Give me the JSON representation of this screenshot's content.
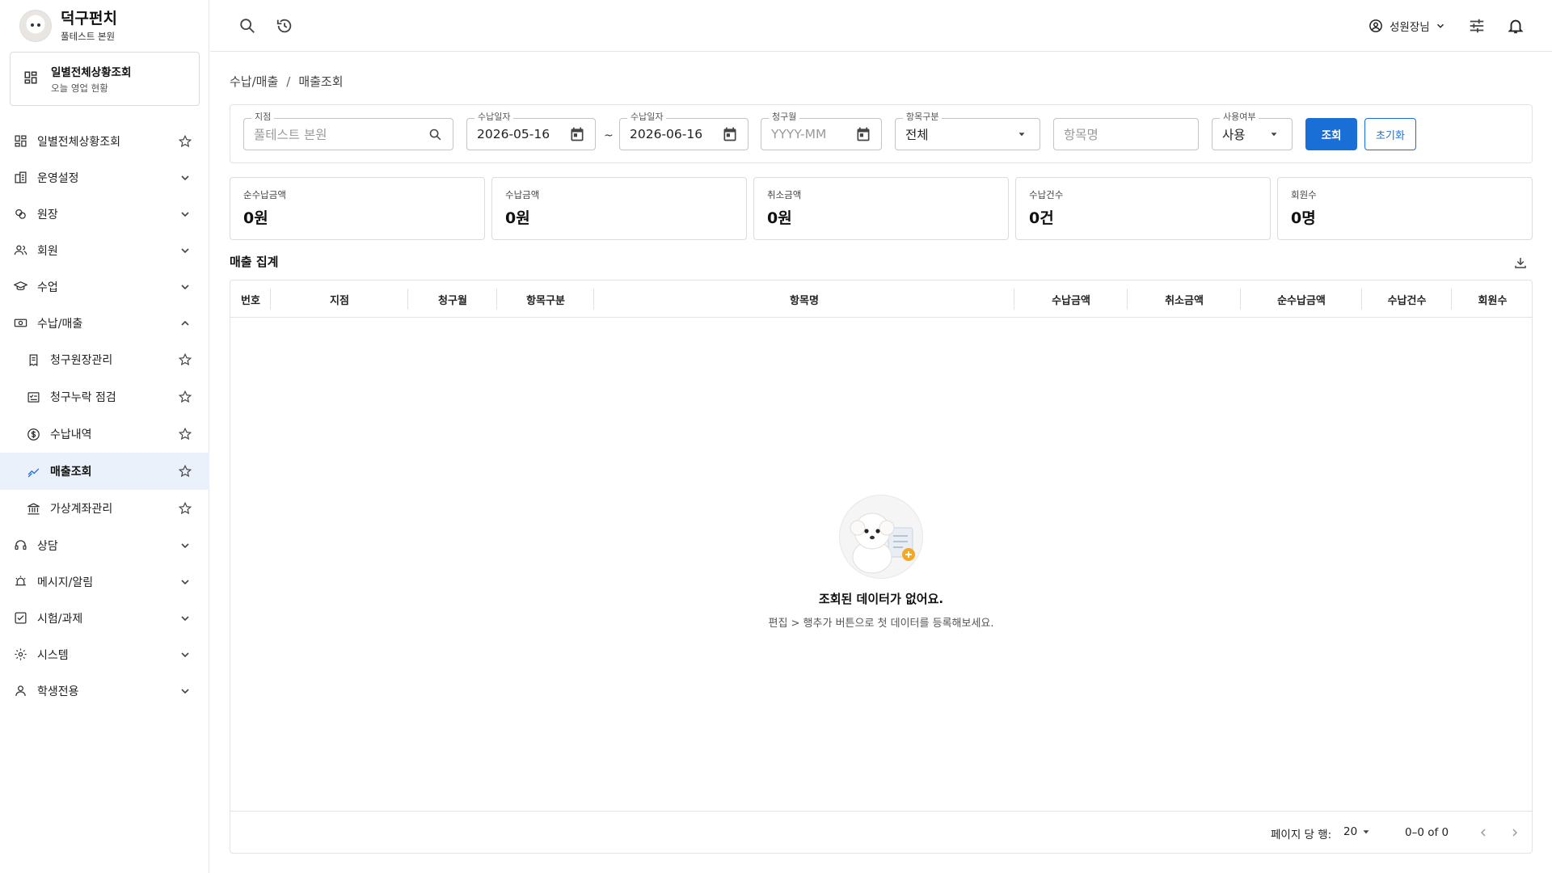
{
  "brand": {
    "name": "덕구펀치",
    "branch": "풀테스트 본원"
  },
  "today_card": {
    "title": "일별전체상황조회",
    "subtitle": "오늘 영업 현황"
  },
  "sidebar": {
    "items": [
      {
        "label": "일별전체상황조회",
        "icon": "dashboard-icon",
        "tail": "star"
      },
      {
        "label": "운영설정",
        "icon": "building-icon",
        "tail": "chevron-down"
      },
      {
        "label": "원장",
        "icon": "ledger-icon",
        "tail": "chevron-down"
      },
      {
        "label": "회원",
        "icon": "people-icon",
        "tail": "chevron-down"
      },
      {
        "label": "수업",
        "icon": "graduation-icon",
        "tail": "chevron-down"
      },
      {
        "label": "수납/매출",
        "icon": "money-icon",
        "tail": "chevron-up"
      },
      {
        "label": "청구원장관리",
        "icon": "receipt-icon",
        "tail": "star",
        "sub": true
      },
      {
        "label": "청구누락 점검",
        "icon": "checklist-icon",
        "tail": "star",
        "sub": true
      },
      {
        "label": "수납내역",
        "icon": "dollar-icon",
        "tail": "star",
        "sub": true
      },
      {
        "label": "매출조회",
        "icon": "chart-icon",
        "tail": "star",
        "sub": true,
        "active": true
      },
      {
        "label": "가상계좌관리",
        "icon": "bank-icon",
        "tail": "star",
        "sub": true
      },
      {
        "label": "상담",
        "icon": "headset-icon",
        "tail": "chevron-down"
      },
      {
        "label": "메시지/알림",
        "icon": "alarm-icon",
        "tail": "chevron-down"
      },
      {
        "label": "시험/과제",
        "icon": "checkbox-icon",
        "tail": "chevron-down"
      },
      {
        "label": "시스템",
        "icon": "gear-icon",
        "tail": "chevron-down"
      },
      {
        "label": "학생전용",
        "icon": "person-icon",
        "tail": "chevron-down"
      }
    ]
  },
  "header": {
    "user_name": "성원장님"
  },
  "breadcrumb": {
    "parent": "수납/매출",
    "separator": "/",
    "current": "매출조회"
  },
  "filters": {
    "branch": {
      "label": "지점",
      "placeholder": "풀테스트 본원"
    },
    "date_from": {
      "label": "수납일자",
      "value": "2026-05-16"
    },
    "tilde": "~",
    "date_to": {
      "label": "수납일자",
      "value": "2026-06-16"
    },
    "billing_month": {
      "label": "청구월",
      "placeholder": "YYYY-MM"
    },
    "item_type": {
      "label": "항목구분",
      "value": "전체"
    },
    "item_name": {
      "placeholder": "항목명"
    },
    "usage": {
      "label": "사용여부",
      "value": "사용"
    },
    "search_button": "조회",
    "reset_button": "초기화"
  },
  "stats": [
    {
      "label": "순수납금액",
      "value": "0원"
    },
    {
      "label": "수납금액",
      "value": "0원"
    },
    {
      "label": "취소금액",
      "value": "0원"
    },
    {
      "label": "수납건수",
      "value": "0건"
    },
    {
      "label": "회원수",
      "value": "0명"
    }
  ],
  "section": {
    "title": "매출 집계"
  },
  "table": {
    "columns": [
      "번호",
      "지점",
      "청구월",
      "항목구분",
      "항목명",
      "수납금액",
      "취소금액",
      "순수납금액",
      "수납건수",
      "회원수"
    ],
    "rows": [],
    "empty_message": "조회된 데이터가 없어요.",
    "empty_hint": "편집 > 행추가 버튼으로 첫 데이터를 등록해보세요."
  },
  "pagination": {
    "rows_per_page_label": "페이지 당 행:",
    "rows_per_page": "20",
    "range": "0–0 of 0"
  },
  "colors": {
    "accent": "#1a6fd6",
    "active_bg": "#ebf1fa"
  }
}
